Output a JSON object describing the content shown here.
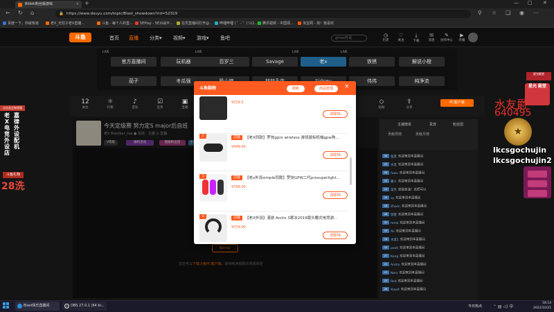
{
  "browser": {
    "tab_title": "Bilibili粉丝版游戏",
    "url": "https://www.douyu.com/topic/Blast_showdown?rid=52319",
    "bookmarks": [
      "百度一下，你就知道",
      "老X_光柱子老X直播...",
      "斗鱼 - 每个人的直...",
      "5EPlay - 5E对战平...",
      "在优直播间打开@...",
      "哔哩哔哩 ( ゜- ゜)つロ...",
      "腾讯视频 - 中国领...",
      "淘宝网 - 淘！我喜欢"
    ]
  },
  "site_header": {
    "logo": "斗鱼",
    "nav": [
      "首页",
      "直播",
      "分类▾",
      "视频▾",
      "游戏▾",
      "鱼吧"
    ],
    "active_nav": "直播",
    "search_placeholder": "gmax外设",
    "icons": [
      "历史",
      "关注",
      "下载",
      "消息",
      "创作中心",
      "开播"
    ]
  },
  "categories": {
    "live_tag": "LIVE",
    "row1": [
      "官方直播间",
      "玩机器",
      "百岁三",
      "Savage",
      "老x",
      "铁锈",
      "解说小橙"
    ],
    "row2": [
      "茄子",
      "冬瓜强",
      "晚小楠",
      "赫赫永夜",
      "Sidney",
      "伟伟",
      "纯净流"
    ],
    "selected": "老x"
  },
  "stats": {
    "items": [
      {
        "label": "关注",
        "value": "12"
      },
      {
        "label": "礼物",
        "value": "☼"
      },
      {
        "label": "音乐",
        "value": "♪"
      },
      {
        "label": "任务",
        "value": "☑"
      },
      {
        "label": "宝箱",
        "value": "▣"
      },
      {
        "label": "开播提醒",
        "value": "⚑"
      },
      {
        "label": "全屏",
        "value": "⤢"
      },
      {
        "label": "钻粉",
        "value": "◇"
      },
      {
        "label": "分享",
        "value": "⇪"
      }
    ],
    "pc_button": "PC客户端"
  },
  "stream": {
    "title": "今天定级赛 努力定S major后自班",
    "sub": "老X Blastbar_top  ● 在线 · 主播  ◎ 直播",
    "chips": [
      "V等级",
      "福利活动",
      "超级粉丝团",
      "主播等级"
    ],
    "below_prefix": "您还可以",
    "below_link": "下载斗鱼PC客户端",
    "below_suffix": "，获得纯净极致的观看体验",
    "below_button": "Barrac"
  },
  "chat": {
    "tabs": [
      "主播榜单",
      "贵宾",
      "粉丝团"
    ],
    "tabs2": [
      "贡献周榜",
      "贡献月榜"
    ],
    "lines": [
      {
        "lv": "30",
        "name": "鱼友",
        "text": "欢迎来到本直播间"
      },
      {
        "lv": "22",
        "name": "水友",
        "text": "欢迎来到本直播间"
      },
      {
        "lv": "18",
        "name": "fuwu",
        "text": "欢迎来到本直播间"
      },
      {
        "lv": "25",
        "name": "路人",
        "text": "欢迎来到本直播间"
      },
      {
        "lv": "12",
        "name": "菜鸟",
        "text": "定级加油！这把可以"
      },
      {
        "lv": "20",
        "name": "xy",
        "text": "欢迎来到本直播间"
      },
      {
        "lv": "16",
        "name": "Zhixin",
        "text": "欢迎来到本直播间"
      },
      {
        "lv": "28",
        "name": "游客",
        "text": "欢迎来到本直播间"
      },
      {
        "lv": "31",
        "name": "mmk",
        "text": "欢迎来到本直播间"
      },
      {
        "lv": "19",
        "name": "Ali",
        "text": "欢迎来到本直播间"
      },
      {
        "lv": "24",
        "name": "水友1",
        "text": "欢迎来到本直播间"
      },
      {
        "lv": "15",
        "name": "pooh",
        "text": "欢迎来到本直播间"
      },
      {
        "lv": "27",
        "name": "Kong",
        "text": "欢迎来到本直播间"
      },
      {
        "lv": "21",
        "name": "Andru",
        "text": "欢迎来到本直播间"
      },
      {
        "lv": "17",
        "name": "Nero",
        "text": "欢迎来到本直播间"
      },
      {
        "lv": "23",
        "name": "Red",
        "text": "欢迎来到本直播间"
      },
      {
        "lv": "26",
        "name": "XiaoX",
        "text": "欢迎来到本直播间"
      }
    ]
  },
  "overlay_left": {
    "banner": "点击关注有惊喜",
    "vert1": "老X电竞外设店",
    "vert2": "嘉律外设配机",
    "gift": "斗鱼礼物",
    "count": "28洗"
  },
  "overlay_right": {
    "badge": "星光殿堂",
    "card": "星光 殿堂",
    "watermark1": "水友爵",
    "watermark2": "640495",
    "name1": "lkcsgochujin",
    "name2": "lkcsgochujin2"
  },
  "modal": {
    "title": "斗鱼购物",
    "refresh": "刷新",
    "manage": "商品管理",
    "close": "×",
    "products": [
      {
        "num": "",
        "tag": "",
        "name": "",
        "price": "¥229.0",
        "detail": "详情TA"
      },
      {
        "num": "2",
        "tag": "店铺",
        "name": "【老X同款】罗技gpro wireless 游戏鼠标机械gpw狗...",
        "price": "¥499.00",
        "detail": "详情TA"
      },
      {
        "num": "3",
        "tag": "店铺",
        "name": "【老x外设simple同款】罗技GPW二代prosuperlight...",
        "price": "¥799.00",
        "detail": "详情TA"
      },
      {
        "num": "4",
        "tag": "店铺",
        "name": "【老X外设】漫游 Arctis 3寒冰2019版头戴式电竞游...",
        "price": "¥379.00",
        "detail": "详情TA"
      }
    ]
  },
  "taskbar": {
    "items": [
      "Blast快乐直播间",
      "OBS 27.0.1 (64 bi..."
    ],
    "weather": "今日热点",
    "time": "18:14",
    "date": "2022/10/22"
  },
  "colors": {
    "brand": "#ff6a00",
    "modal_accent": "#ff5a1f",
    "selected_cat": "#1f5f8a"
  }
}
